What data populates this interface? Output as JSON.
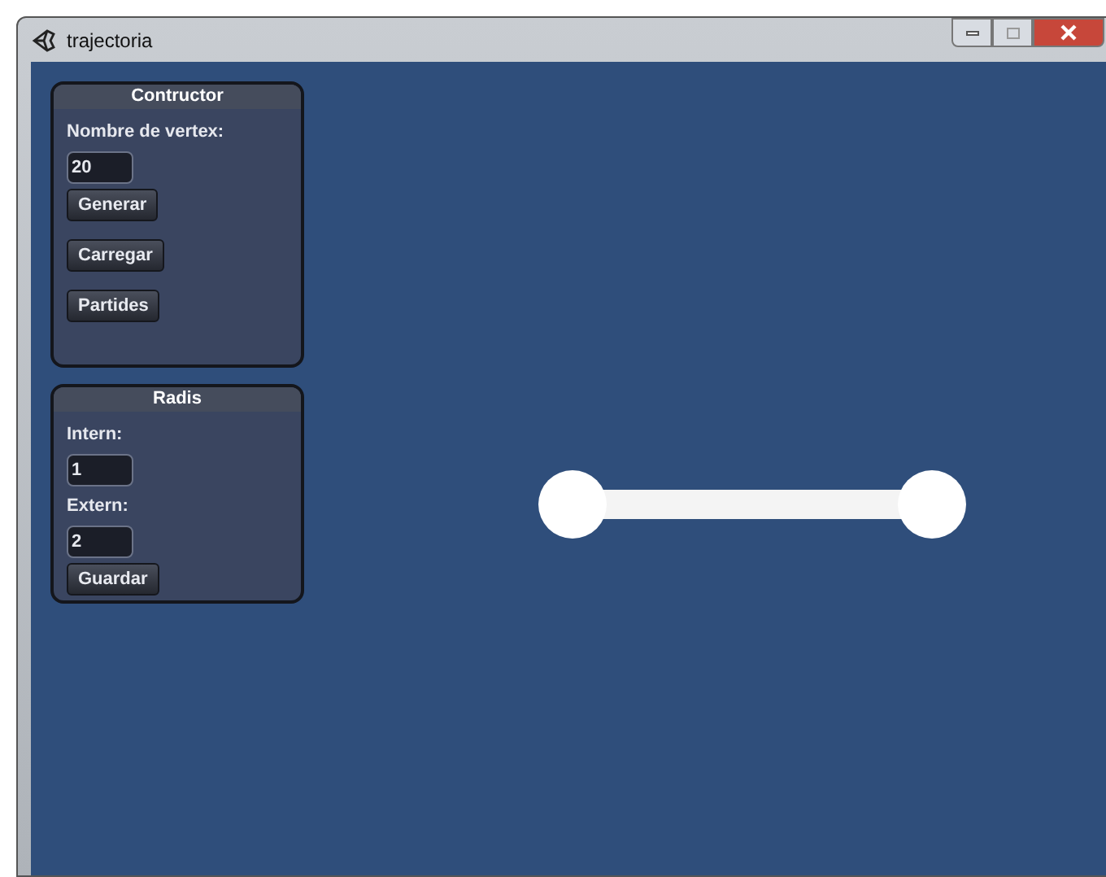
{
  "window": {
    "title": "trajectoria"
  },
  "panels": [
    {
      "title": "Contructor",
      "items": [
        {
          "kind": "label",
          "text": "Nombre de vertex:"
        },
        {
          "kind": "field",
          "value": "20"
        },
        {
          "kind": "button",
          "text": "Generar"
        },
        {
          "kind": "button",
          "text": "Carregar"
        },
        {
          "kind": "button",
          "text": "Partides"
        }
      ]
    },
    {
      "title": "Radis",
      "items": [
        {
          "kind": "label",
          "text": "Intern:"
        },
        {
          "kind": "field",
          "value": "1"
        },
        {
          "kind": "label",
          "text": "Extern:"
        },
        {
          "kind": "field",
          "value": "2"
        },
        {
          "kind": "button",
          "text": "Guardar"
        }
      ]
    }
  ]
}
